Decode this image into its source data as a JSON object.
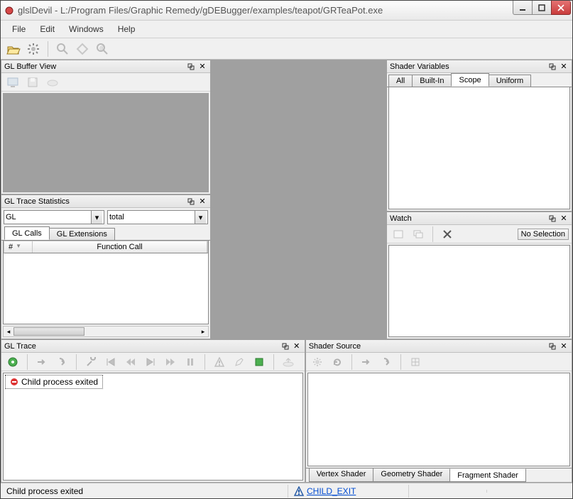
{
  "title": "glslDevil - L:/Program Files/Graphic Remedy/gDEBugger/examples/teapot/GRTeaPot.exe",
  "menubar": [
    "File",
    "Edit",
    "Windows",
    "Help"
  ],
  "panels": {
    "bufferView": {
      "title": "GL Buffer View"
    },
    "traceStats": {
      "title": "GL Trace Statistics",
      "group": "GL",
      "mode": "total",
      "tabs": [
        "GL Calls",
        "GL Extensions"
      ],
      "columns": [
        "#",
        "Function Call"
      ]
    },
    "shaderVars": {
      "title": "Shader Variables",
      "tabs": [
        "All",
        "Built-In",
        "Scope",
        "Uniform"
      ],
      "active": "Scope"
    },
    "watch": {
      "title": "Watch",
      "selection": "No Selection"
    },
    "glTrace": {
      "title": "GL Trace",
      "message": "Child process exited"
    },
    "shaderSource": {
      "title": "Shader Source",
      "tabs": [
        "Vertex Shader",
        "Geometry Shader",
        "Fragment Shader"
      ],
      "active": "Fragment Shader"
    }
  },
  "statusbar": {
    "message": "Child process exited",
    "code": "CHILD_EXIT"
  }
}
